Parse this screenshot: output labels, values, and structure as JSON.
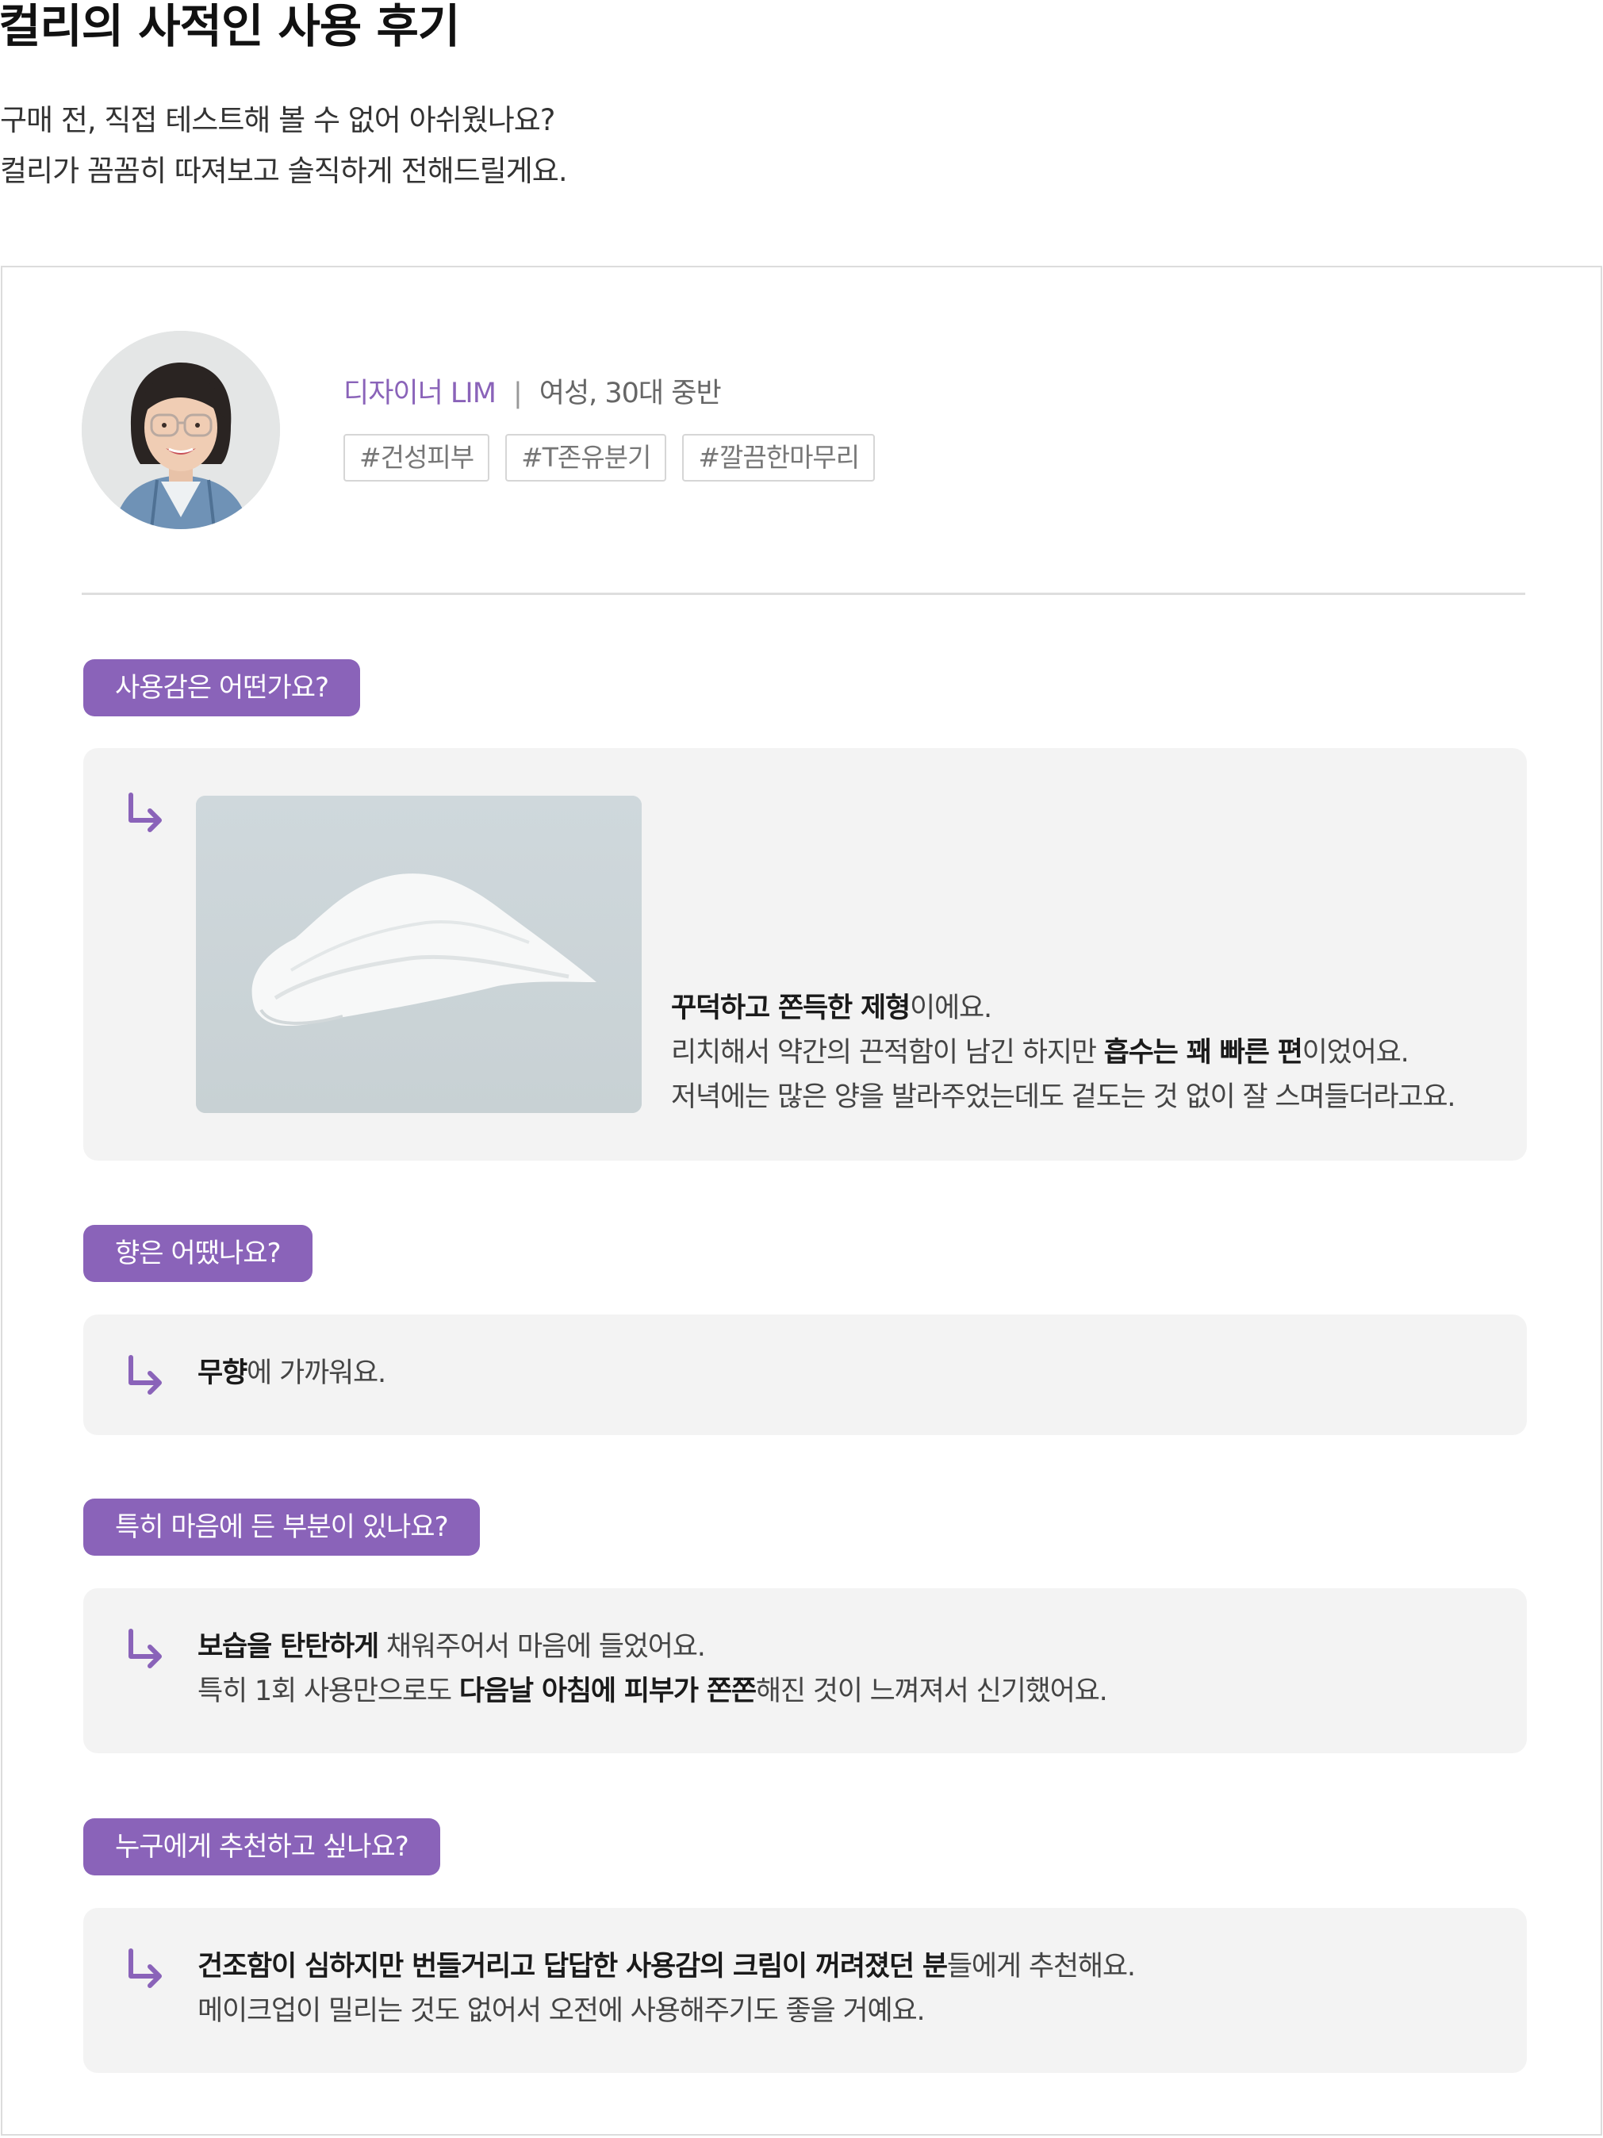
{
  "header": {
    "title": "컬리의 사적인 사용 후기",
    "intro_line1": "구매 전, 직접 테스트해 볼 수 없어 아쉬웠나요?",
    "intro_line2": "컬리가 꼼꼼히 따져보고 솔직하게 전해드릴게요."
  },
  "profile": {
    "name": "디자이너 LIM",
    "separator": "|",
    "info": "여성, 30대 중반",
    "tags": [
      "#건성피부",
      "#T존유분기",
      "#깔끔한마무리"
    ]
  },
  "qa": [
    {
      "question": "사용감은 어떤가요?",
      "lines": [
        [
          {
            "t": "꾸덕하고 쫀득한 제형",
            "b": true
          },
          {
            "t": "이에요.",
            "b": false
          }
        ],
        [
          {
            "t": "리치해서 약간의 끈적함이 남긴 하지만 ",
            "b": false
          },
          {
            "t": "흡수는 꽤 빠른 편",
            "b": true
          },
          {
            "t": "이었어요.",
            "b": false
          }
        ],
        [
          {
            "t": "저녁에는 많은 양을 발라주었는데도 겉도는 것 없이 잘 스며들더라고요.",
            "b": false
          }
        ]
      ]
    },
    {
      "question": "향은 어땠나요?",
      "lines": [
        [
          {
            "t": "무향",
            "b": true
          },
          {
            "t": "에 가까워요.",
            "b": false
          }
        ]
      ]
    },
    {
      "question": "특히 마음에 든 부분이 있나요?",
      "lines": [
        [
          {
            "t": "보습을 탄탄하게",
            "b": true
          },
          {
            "t": " 채워주어서 마음에 들었어요.",
            "b": false
          }
        ],
        [
          {
            "t": "특히 1회 사용만으로도 ",
            "b": false
          },
          {
            "t": "다음날 아침에 피부가 쫀쫀",
            "b": true
          },
          {
            "t": "해진 것이 느껴져서 신기했어요.",
            "b": false
          }
        ]
      ]
    },
    {
      "question": "누구에게 추천하고 싶나요?",
      "lines": [
        [
          {
            "t": "건조함이 심하지만 번들거리고 답답한 사용감의 크림이 꺼려졌던 분",
            "b": true
          },
          {
            "t": "들에게 추천해요.",
            "b": false
          }
        ],
        [
          {
            "t": "메이크업이 밀리는 것도 없어서 오전에 사용해주기도 좋을 거예요.",
            "b": false
          }
        ]
      ]
    }
  ],
  "colors": {
    "accent": "#8a63b9",
    "answer_bg": "#f3f3f3",
    "text": "#333333",
    "bold_text": "#1a1a1a"
  },
  "icons": {
    "answer_arrow": "arrow-down-right-icon",
    "avatar": "reviewer-avatar",
    "product": "cream-texture-image"
  }
}
